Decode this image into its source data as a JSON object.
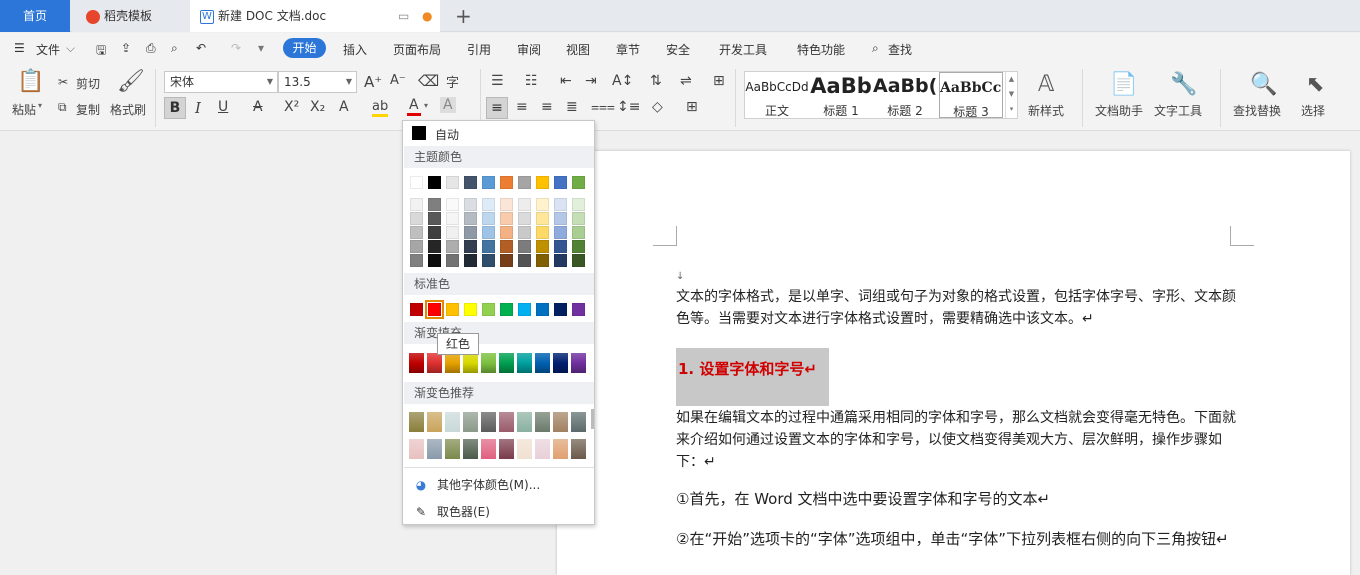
{
  "tabs": {
    "home": "首页",
    "template": "稻壳模板",
    "doc": "新建 DOC 文档.doc"
  },
  "menu": {
    "file": "文件",
    "start": "开始",
    "insert": "插入",
    "layout": "页面布局",
    "reference": "引用",
    "review": "审阅",
    "view": "视图",
    "chapter": "章节",
    "security": "安全",
    "dev_tools": "开发工具",
    "special": "特色功能",
    "search": "查找"
  },
  "ribbon": {
    "paste": "粘贴",
    "cut": "剪切",
    "copy": "复制",
    "format_painter": "格式刷",
    "font_name": "宋体",
    "font_size": "13.5",
    "bold": "B",
    "italic": "I",
    "underline": "U",
    "styles": [
      {
        "preview": "AaBbCcDd",
        "name": "正文"
      },
      {
        "preview": "AaBb",
        "name": "标题 1"
      },
      {
        "preview": "AaBb(",
        "name": "标题 2"
      },
      {
        "preview": "AaBbCcI",
        "name": "标题 3"
      }
    ],
    "new_style": "新样式",
    "doc_assistant": "文档助手",
    "text_tools": "文字工具",
    "find_replace": "查找替换",
    "select": "选择"
  },
  "color_menu": {
    "auto": "自动",
    "theme_colors": "主题颜色",
    "standard_colors": "标准色",
    "gradient_fill": "渐变填充",
    "gradient_recommended": "渐变色推荐",
    "more_colors": "其他字体颜色(M)...",
    "eyedropper": "取色器(E)",
    "tooltip": "红色",
    "theme_top": [
      "#ffffff",
      "#000000",
      "#e7e6e6",
      "#44546a",
      "#5b9bd5",
      "#ed7d31",
      "#a5a5a5",
      "#ffc000",
      "#4472c4",
      "#70ad47"
    ],
    "standard": [
      "#c00000",
      "#ff0000",
      "#ffc000",
      "#ffff00",
      "#92d050",
      "#00b050",
      "#00b0f0",
      "#0070c0",
      "#002060",
      "#7030a0"
    ],
    "gradient": [
      "#c00000",
      "#e03030",
      "#e6a200",
      "#d8d800",
      "#7cc040",
      "#00a050",
      "#00a0a0",
      "#0060b0",
      "#002070",
      "#7030a0"
    ]
  },
  "document": {
    "para1": "文本的字体格式，是以单字、词组或句子为对象的格式设置，包括字体字号、字形、文本颜色等。当需要对文本进行字体格式设置时，需要精确选中该文本。↵",
    "heading": "1. 设置字体和字号↵",
    "para2": "如果在编辑文本的过程中通篇采用相同的字体和字号，那么文档就会变得毫无特色。下面就来介绍如何通过设置文本的字体和字号，以使文档变得美观大方、层次鲜明，操作步骤如下：↵",
    "step1": "①首先，在 Word 文档中选中要设置字体和字号的文本↵",
    "step2": "②在“开始”选项卡的“字体”选项组中，单击“字体”下拉列表框右侧的向下三角按钮↵"
  }
}
